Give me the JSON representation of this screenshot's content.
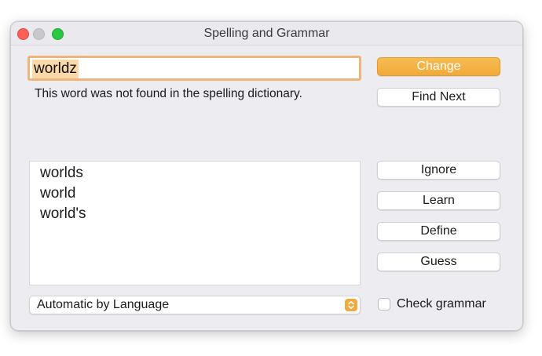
{
  "window": {
    "title": "Spelling and Grammar"
  },
  "word": {
    "value": "worldz"
  },
  "notice": "This word was not found in the spelling dictionary.",
  "buttons": {
    "change": "Change",
    "find_next": "Find Next",
    "ignore": "Ignore",
    "learn": "Learn",
    "define": "Define",
    "guess": "Guess"
  },
  "suggestions": [
    "worlds",
    "world",
    "world's"
  ],
  "language": {
    "selected": "Automatic by Language"
  },
  "check_grammar": {
    "label": "Check grammar",
    "checked": false
  },
  "colors": {
    "accent": "#f2a93a",
    "selection": "#fbd8a8",
    "focus_ring": "#efb47a"
  }
}
